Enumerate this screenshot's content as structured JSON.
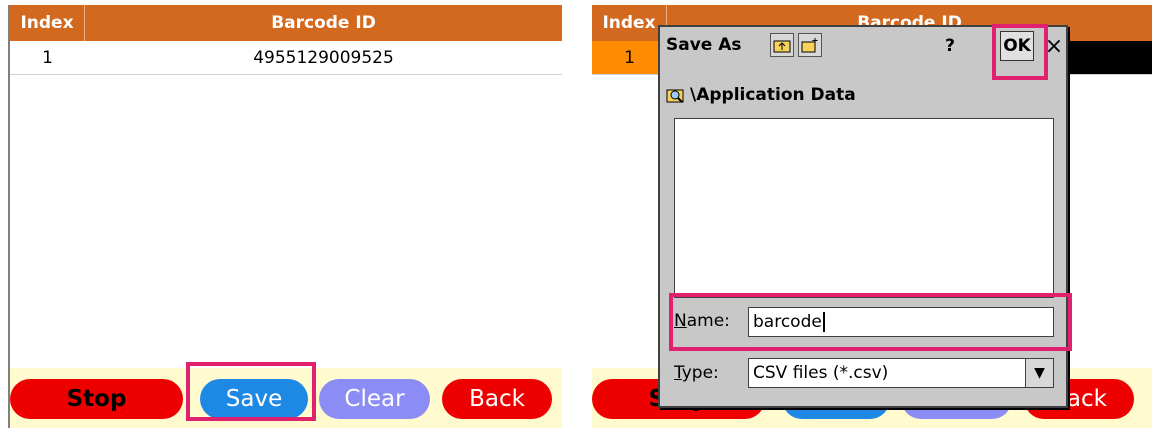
{
  "table": {
    "col_index": "Index",
    "col_barcode": "Barcode ID",
    "rows": [
      {
        "index": "1",
        "barcode": "4955129009525"
      }
    ]
  },
  "buttons": {
    "stop": "Stop",
    "save": "Save",
    "clear": "Clear",
    "back": "Back"
  },
  "right_partial": {
    "header_index": "Index",
    "header_barcode": "Barcode ID",
    "row_index": "1",
    "stop_fragment": "Stop",
    "back_fragment": "Back"
  },
  "dialog": {
    "title": "Save As",
    "help_label": "?",
    "ok_label": "OK",
    "close_label": "×",
    "path": "\\Application Data",
    "name_label_u": "N",
    "name_label_rest": "ame:",
    "name_value": "barcode",
    "type_label_u": "T",
    "type_label_rest": "ype:",
    "type_value": "CSV files (*.csv)"
  },
  "colors": {
    "header": "#d2691e",
    "highlight": "#e0216f",
    "stop": "#ee0000",
    "save": "#1e88e5",
    "clear": "#8c8cf5"
  }
}
